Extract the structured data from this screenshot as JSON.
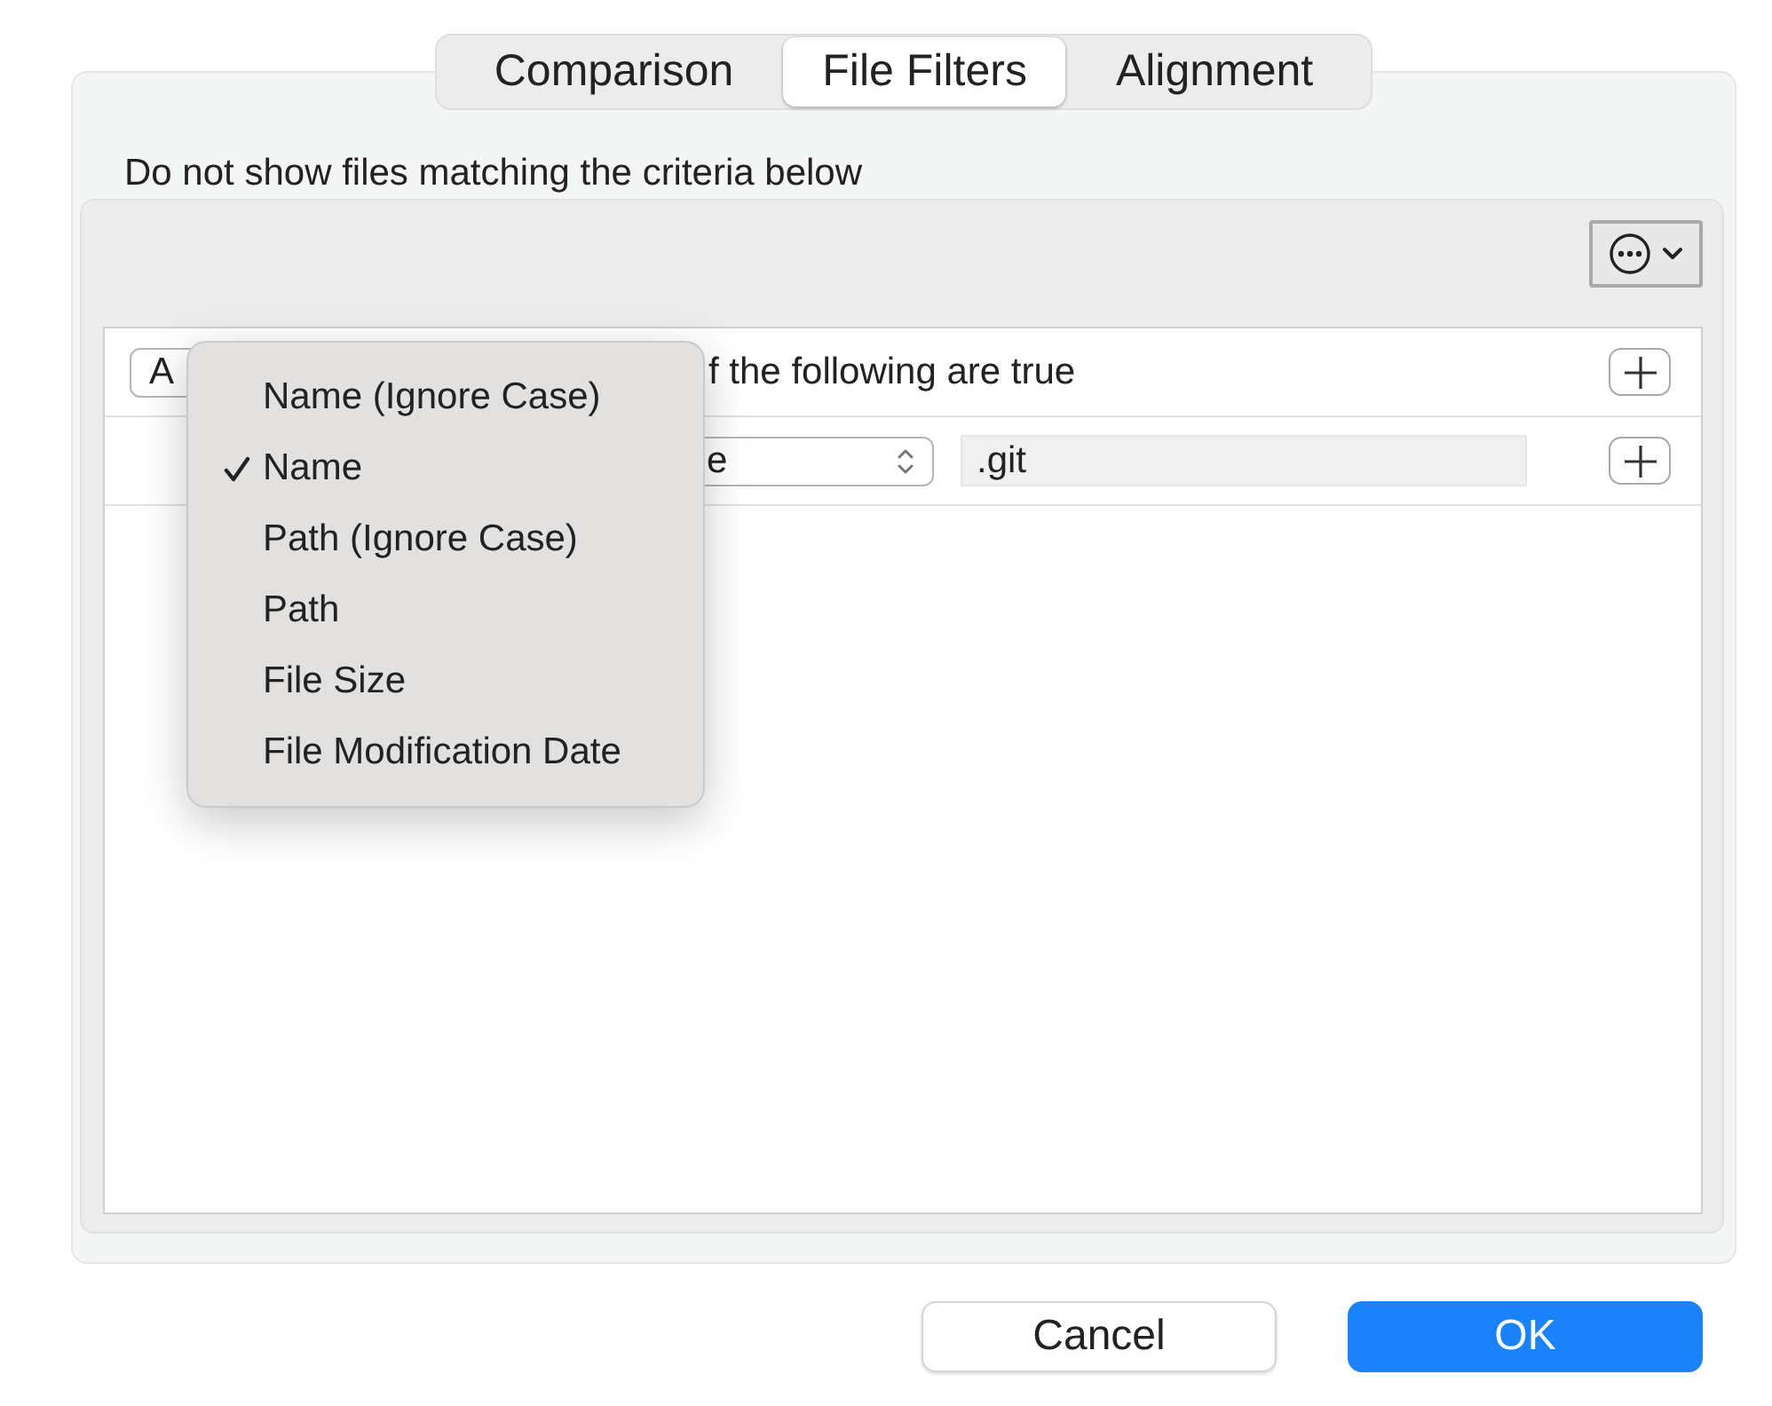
{
  "tabs": [
    {
      "label": "Comparison",
      "selected": false
    },
    {
      "label": "File Filters",
      "selected": true
    },
    {
      "label": "Alignment",
      "selected": false
    }
  ],
  "description": "Do not show files matching the criteria below",
  "rules": [
    {
      "kind": "header",
      "popup": "A",
      "text": "f the following are true"
    },
    {
      "kind": "criterion",
      "popup": "e",
      "value": ".git"
    }
  ],
  "menu": {
    "items": [
      {
        "label": "Name (Ignore Case)",
        "checked": false
      },
      {
        "label": "Name",
        "checked": true
      },
      {
        "label": "Path (Ignore Case)",
        "checked": false
      },
      {
        "label": "Path",
        "checked": false
      },
      {
        "label": "File Size",
        "checked": false
      },
      {
        "label": "File Modification Date",
        "checked": false
      }
    ]
  },
  "buttons": [
    {
      "label": "Cancel",
      "primary": false
    },
    {
      "label": "OK",
      "primary": true
    }
  ]
}
